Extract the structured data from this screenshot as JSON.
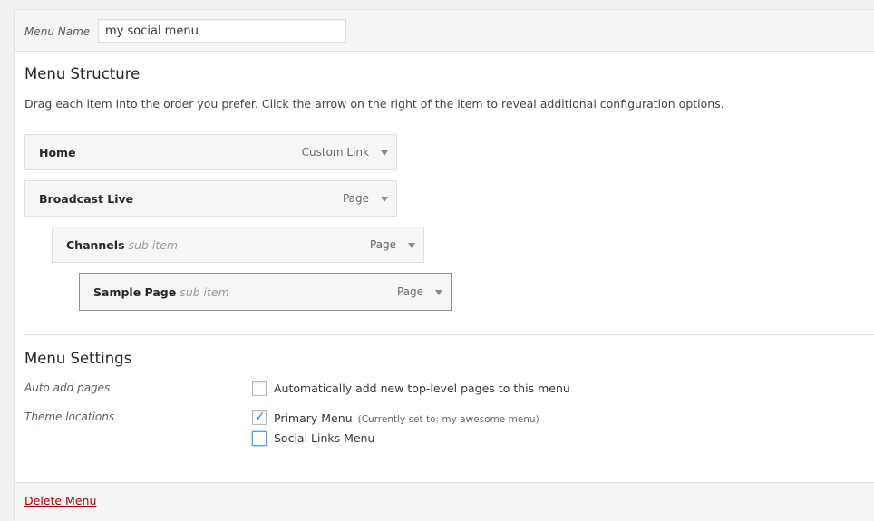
{
  "menu_name": {
    "label": "Menu Name",
    "value": "my social menu"
  },
  "structure": {
    "title": "Menu Structure",
    "description": "Drag each item into the order you prefer. Click the arrow on the right of the item to reveal additional configuration options.",
    "items": [
      {
        "title": "Home",
        "sub_label": "",
        "type": "Custom Link"
      },
      {
        "title": "Broadcast Live",
        "sub_label": "",
        "type": "Page"
      },
      {
        "title": "Channels",
        "sub_label": "sub item",
        "type": "Page"
      },
      {
        "title": "Sample Page",
        "sub_label": "sub item",
        "type": "Page"
      }
    ]
  },
  "settings": {
    "title": "Menu Settings",
    "auto_add": {
      "label": "Auto add pages",
      "option": "Automatically add new top-level pages to this menu",
      "checked": false
    },
    "theme_locations": {
      "label": "Theme locations",
      "options": [
        {
          "label": "Primary Menu",
          "note": "(Currently set to: my awesome menu)",
          "checked": true
        },
        {
          "label": "Social Links Menu",
          "note": "",
          "checked": false
        }
      ]
    }
  },
  "footer": {
    "delete_label": "Delete Menu"
  },
  "colors": {
    "link_delete": "#aa0000",
    "checkbox_check": "#1e8cbe",
    "focus_border": "#5b9dd9"
  }
}
